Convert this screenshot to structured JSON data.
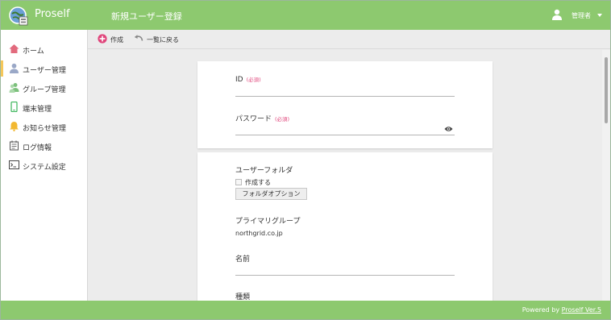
{
  "header": {
    "app_name": "Proself",
    "page_title": "新規ユーザー登録",
    "user_name": "管理者"
  },
  "sidebar": {
    "items": [
      {
        "label": "ホーム",
        "icon": "home-icon"
      },
      {
        "label": "ユーザー管理",
        "icon": "user-icon",
        "active": true
      },
      {
        "label": "グループ管理",
        "icon": "group-icon"
      },
      {
        "label": "端末管理",
        "icon": "device-icon"
      },
      {
        "label": "お知らせ管理",
        "icon": "bell-icon"
      },
      {
        "label": "ログ情報",
        "icon": "log-icon"
      },
      {
        "label": "システム設定",
        "icon": "terminal-icon"
      }
    ]
  },
  "toolbar": {
    "create_label": "作成",
    "back_label": "一覧に戻る"
  },
  "form": {
    "id_label": "ID",
    "required": "(必須)",
    "password_label": "パスワード",
    "user_folder_label": "ユーザーフォルダ",
    "create_checkbox_label": "作成する",
    "folder_option_button": "フォルダオプション",
    "primary_group_label": "プライマリグループ",
    "primary_group_value": "northgrid.co.jp",
    "name_label": "名前",
    "type_label": "種類"
  },
  "footer": {
    "powered_by": "Powered by",
    "link_text": "Proself Ver.5"
  },
  "colors": {
    "header_green": "#8dc96f",
    "required_pink": "#e0457b",
    "create_icon": "#e0457b",
    "active_marker": "#f5c75a"
  }
}
